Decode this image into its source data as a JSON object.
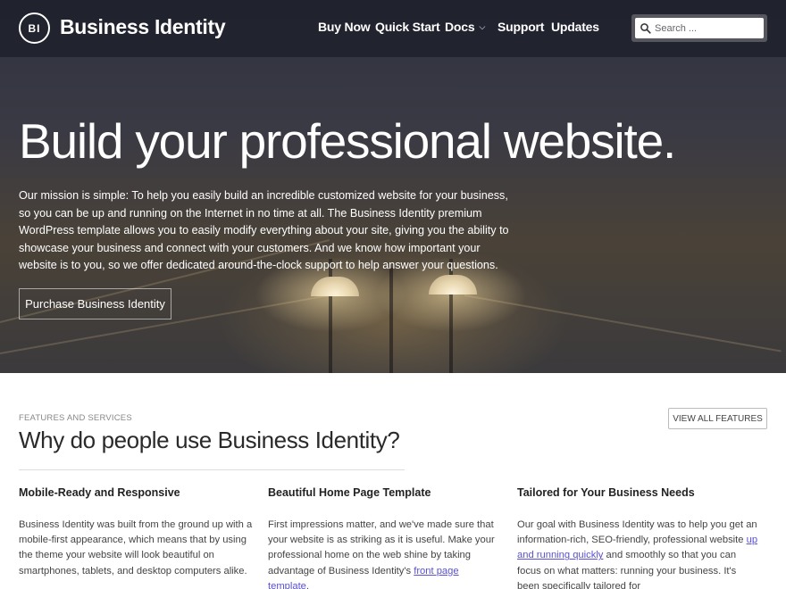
{
  "header": {
    "logo_text": "BI",
    "site_title": "Business Identity",
    "nav": [
      {
        "label": "Buy Now"
      },
      {
        "label": "Quick Start"
      },
      {
        "label": "Docs",
        "has_dropdown": true
      },
      {
        "label": "Support"
      },
      {
        "label": "Updates"
      }
    ],
    "search": {
      "placeholder": "Search ..."
    }
  },
  "hero": {
    "title": "Build your professional website.",
    "text": "Our mission is simple: To help you easily build an incredible customized website for your business, so you can be up and running on the Internet in no time at all. The Business Identity premium WordPress template allows you to easily modify everything about your site, giving you the ability to showcase your business and connect with your customers. And we know how important your website is to you, so we offer dedicated around-the-clock support to help answer your questions.",
    "cta_label": "Purchase Business Identity"
  },
  "features": {
    "kicker": "FEATURES AND SERVICES",
    "title": "Why do people use Business Identity?",
    "view_all_label": "VIEW ALL FEATURES",
    "items": [
      {
        "title": "Mobile-Ready and Responsive",
        "text": "Business Identity was built from the ground up with a mobile-first appearance, which means that by using the theme your website will look beautiful on smartphones, tablets, and desktop computers alike."
      },
      {
        "title": "Beautiful Home Page Template",
        "text_before": "First impressions matter, and we've made sure that your website is as striking as it is useful. Make your professional home on the web shine by taking advantage of Business Identity's ",
        "link": "front page template",
        "text_after": "."
      },
      {
        "title": "Tailored for Your Business Needs",
        "text_before": "Our goal with Business Identity was to help you get an information-rich, SEO-friendly, professional website ",
        "link": "up and running quickly",
        "text_after": " and smoothly so that you can focus on what matters: running your business. It's been specifically tailored for"
      }
    ]
  },
  "colors": {
    "header_bg": "#20222c",
    "link": "#5a4fd6",
    "text": "#444444"
  }
}
